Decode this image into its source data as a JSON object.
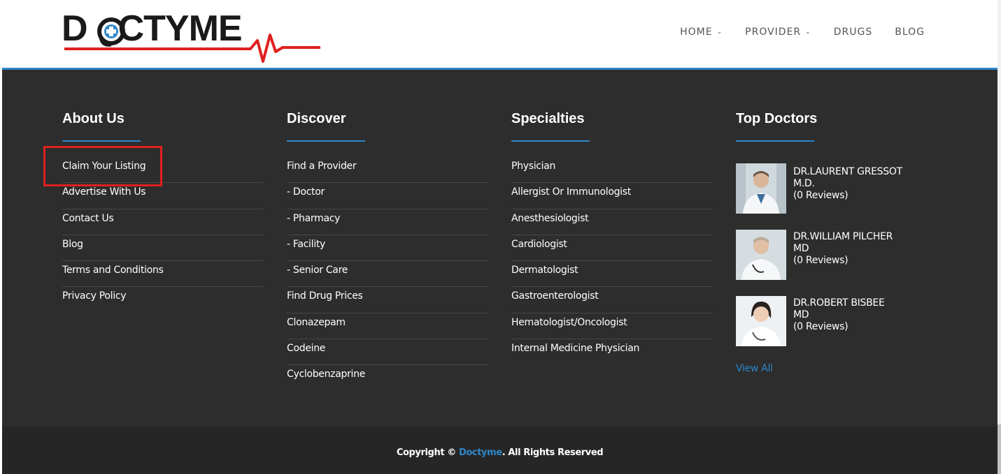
{
  "brand": {
    "logo_text_pre": "D",
    "logo_text_post": "CTYME",
    "accent": "#2e86c9",
    "heartbeat_color": "#e02020"
  },
  "nav": {
    "items": [
      {
        "label": "HOME",
        "has_dropdown": true,
        "icon": "chevron-down-icon"
      },
      {
        "label": "PROVIDER",
        "has_dropdown": true,
        "icon": "chevron-down-icon"
      },
      {
        "label": "DRUGS",
        "has_dropdown": false
      },
      {
        "label": "BLOG",
        "has_dropdown": false
      }
    ]
  },
  "footer": {
    "about": {
      "title": "About Us",
      "links": [
        "Claim Your Listing",
        "Advertise With Us",
        "Contact Us",
        "Blog",
        "Terms and Conditions",
        "Privacy Policy"
      ]
    },
    "discover": {
      "title": "Discover",
      "links": [
        "Find a Provider",
        "-  Doctor",
        "-  Pharmacy",
        "-  Facility",
        "-  Senior Care",
        "Find Drug Prices",
        "Clonazepam",
        "Codeine",
        "Cyclobenzaprine"
      ]
    },
    "specialties": {
      "title": "Specialties",
      "links": [
        "Physician",
        "Allergist Or Immunologist",
        "Anesthesiologist",
        "Cardiologist",
        "Dermatologist",
        "Gastroenterologist",
        "Hematologist/Oncologist",
        "Internal Medicine Physician"
      ]
    },
    "top_doctors": {
      "title": "Top Doctors",
      "doctors": [
        {
          "name_line1": "DR.LAURENT GRESSOT",
          "name_line2": "M.D.",
          "reviews": "(0 Reviews)"
        },
        {
          "name_line1": "DR.WILLIAM PILCHER",
          "name_line2": "MD",
          "reviews": "(0 Reviews)"
        },
        {
          "name_line1": "DR.ROBERT BISBEE",
          "name_line2": "MD",
          "reviews": "(0 Reviews)"
        }
      ],
      "view_all": "View All"
    }
  },
  "copyright": {
    "prefix": "Copyright © ",
    "brand": "Doctyme",
    "suffix": ". All Rights Reserved"
  }
}
